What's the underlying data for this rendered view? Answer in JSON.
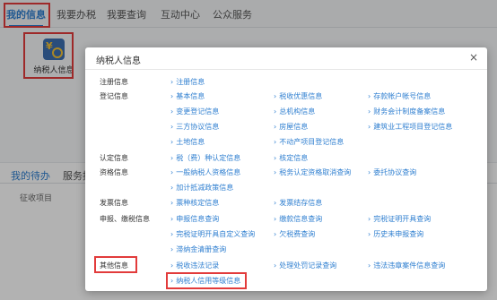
{
  "topnav": {
    "tabs": [
      "我的信息",
      "我要办税",
      "我要查询",
      "互动中心",
      "公众服务"
    ]
  },
  "tile": {
    "label": "纳税人信息"
  },
  "bottom": {
    "tabs": [
      "我的待办",
      "服务提"
    ],
    "sub_label": "征收项目"
  },
  "modal": {
    "title": "纳税人信息",
    "close": "×",
    "categories": {
      "c0": "注册信息",
      "c1": "登记信息",
      "c2": "认定信息",
      "c3": "资格信息",
      "c4": "发票信息",
      "c5": "申报、缴税信息",
      "c6": "其他信息"
    },
    "links": {
      "l00": "注册信息",
      "l10": "基本信息",
      "l11": "税收优惠信息",
      "l12": "存款帐户帐号信息",
      "l13": "变更登记信息",
      "l14": "总机构信息",
      "l15": "财务会计制度备案信息",
      "l16": "三方协议信息",
      "l17": "房屋信息",
      "l18": "建筑业工程项目登记信息",
      "l19": "土地信息",
      "l1a": "不动产项目登记信息",
      "l20": "税（费）种认定信息",
      "l21": "核定信息",
      "l30": "一般纳税人资格信息",
      "l31": "税务认定资格取消查询",
      "l32": "委托协议查询",
      "l33": "加计抵减政策信息",
      "l40": "票种核定信息",
      "l41": "发票结存信息",
      "l50": "申报信息查询",
      "l51": "缴款信息查询",
      "l52": "完税证明开具查询",
      "l53": "完税证明开具自定义查询",
      "l54": "欠税费查询",
      "l55": "历史未申报查询",
      "l56": "滞纳金清册查询",
      "l60": "税收违法记录",
      "l61": "处理处罚记录查询",
      "l62": "违法违章案件信息查询",
      "l63": "纳税人信用等级信息"
    }
  }
}
